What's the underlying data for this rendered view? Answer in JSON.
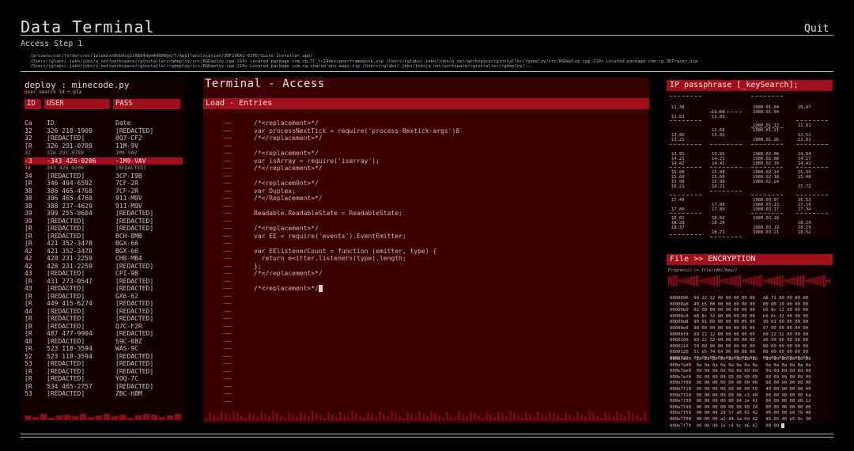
{
  "app": {
    "title": "Data Terminal",
    "quit_label": "Quit",
    "step": "Access Step 1",
    "paths": [
      "/private/var/folders/wc/1plpkbsn0hb0cg1t6884dym40000gn/T/AppTranslocation/30F196A1-03FE/Suite Installer.app/",
      "/Users/rglabs/.jekn/jobs/q_net/workspace/rginstaller/rgdeploy/src/RGDeploy.cpp:210> Located package com.rg.TC_tc14designerframework.zip /Users/rglabs/.jekn/jobs/q_net/workspace/rginstaller/rgdeploy/src/RGDeploy.cpp:210> Located package com.rg.3DTracer.zip",
      "/Users/rglabs/.jekn/jobs/q_net/workspace/rginstaller/rgdeploy/src/RGDeploy.cpp:210> Located package com.rg.shared-env-maps.zip /Users/rglabs/.jekn/jobs/q_net/workspace/rginstaller/rgdeploy/..."
    ]
  },
  "left_panel": {
    "title": "deploy : minecode.py",
    "search": "User search id + p[a",
    "headers": [
      "ID",
      "USER",
      "PASS"
    ],
    "rows": [
      [
        "Ca",
        "ID",
        "Date"
      ],
      [
        "32",
        "326 218-1909",
        "[REDACTED]"
      ],
      [
        "32",
        "[REDACTED]",
        "0Q7-CF2"
      ],
      [
        "[R",
        "326 291-0789",
        "11M-9V"
      ],
      [
        "32",
        "326 291-0789",
        "1M9-VAV"
      ],
      [
        "-3",
        "-343 426-0206",
        "-1M9-VAV"
      ],
      [
        "34",
        "343 426-0206",
        "[REDACTED]"
      ],
      [
        "34",
        "[REDACTED]",
        "3CP-I9B"
      ],
      [
        "[R",
        "346 494-6592",
        "7CF-2R"
      ],
      [
        "38",
        "386 465-4768",
        "7CF-2R"
      ],
      [
        "38",
        "386 465-4768",
        "911-M9V"
      ],
      [
        "38",
        "388 237-4629",
        "911-M9V"
      ],
      [
        "39",
        "399 255-8604",
        "[REDACTED]"
      ],
      [
        "39",
        "[REDACTED]",
        "[REDACTED]"
      ],
      [
        "[R",
        "[REDACTED]",
        "[REDACTED]"
      ],
      [
        "[R",
        "[REDACTED]",
        "BCH-8MB"
      ],
      [
        "[R",
        "421 352-3478",
        "BGX-66"
      ],
      [
        "42",
        "421 352-3478",
        "BGX-66"
      ],
      [
        "42",
        "428 231-2259",
        "CH8-MB4"
      ],
      [
        "42",
        "428 231-2259",
        "[REDACTED]"
      ],
      [
        "43",
        "[REDACTED]",
        "CPI-9B"
      ],
      [
        "[R",
        "431 273-0547",
        "[REDACTED]"
      ],
      [
        "43",
        "[REDACTED]",
        "[REDACTED]"
      ],
      [
        "[R",
        "[REDACTED]",
        "GX6-62"
      ],
      [
        "[R",
        "449 415-6274",
        "[REDACTED]"
      ],
      [
        "44",
        "[REDACTED]",
        "[REDACTED]"
      ],
      [
        "[R",
        "[REDACTED]",
        "[REDACTED]"
      ],
      [
        "[R",
        "[REDACTED]",
        "Q7C-F2R"
      ],
      [
        "[R",
        "487 477-9904",
        "[REDACTED]"
      ],
      [
        "48",
        "[REDACTED]",
        "S9C-08Z"
      ],
      [
        "[R",
        "523 118-3594",
        "WAS-9C"
      ],
      [
        "52",
        "523 118-3594",
        "[REDACTED]"
      ],
      [
        "53",
        "[REDACTED]",
        "[REDACTED]"
      ],
      [
        "[R",
        "[REDACTED]",
        "[REDACTED]"
      ],
      [
        "[R",
        "[REDACTED]",
        "YOQ-7C"
      ],
      [
        "[R",
        "534 465-2757",
        "[REDACTED]"
      ],
      [
        "53",
        "[REDACTED]",
        "ZBC-H8M"
      ]
    ],
    "selected_row": 5,
    "dim_rows": [
      4,
      6
    ]
  },
  "terminal": {
    "title": "Terminal - Access",
    "load_label": "Load - Entries",
    "dash": "——",
    "code": [
      "/*<replacement>*/",
      "var processNextTick = require('process-Bextick-args')8",
      "/*</replacement>*/",
      "",
      "/*<replacement>*/",
      "var isArray = require('isarray');",
      "/*</replacement>*/",
      "",
      "/*<replacem9nt>*/",
      "var Duplex;",
      "/*</Replacement>*/",
      "",
      "Readable.ReadableState = ReadableState;",
      "",
      "/*<replacement>*/",
      "var EE = require('events').EventEmitter;",
      "",
      "var EElistenerCount = function (emitter, type) {",
      "  return e<itter.listeners(type).length;",
      "};",
      "/*</replacement>*/",
      "",
      "/*<replacement>*/"
    ]
  },
  "ip_panel": {
    "title": "IP passphrase [_keySearch];",
    "rows": [
      [
        "11.38",
        "",
        "1980.01.04",
        "10.47"
      ],
      [
        "",
        "11.50",
        "1980.01.04",
        ""
      ],
      [
        "11.83",
        "11.83",
        "",
        ""
      ],
      [
        "",
        "",
        "1980.01.13",
        "11.91"
      ],
      [
        "",
        "12.68",
        "1980.01.21",
        ""
      ],
      [
        "13.02",
        "13.02",
        "",
        "12.51"
      ],
      [
        "13.21",
        "",
        "1980.01.26",
        "12.81"
      ],
      [
        "13.91",
        "13.91",
        "1980.02.06",
        "14.04"
      ],
      [
        "14.21",
        "14.21",
        "1980.02.08",
        "14.27"
      ],
      [
        "14.42",
        "14.42",
        "1980.02.10",
        "14.42"
      ],
      [
        "15.48",
        "15.48",
        "1980.02.14",
        "15.39"
      ],
      [
        "15.60",
        "15.60",
        "1980.02.18",
        "15.48"
      ],
      [
        "15.98",
        "15.98",
        "1980.02.24",
        ""
      ],
      [
        "16.21",
        "16.21",
        "",
        "15.72"
      ],
      [
        "17.48",
        "",
        "1980.03.07",
        "16.53"
      ],
      [
        "",
        "17.88",
        "1980.03.13",
        "17.16"
      ],
      [
        "17.89",
        "17.89",
        "1980.03.17",
        "17.34"
      ],
      [
        "18.02",
        "18.02",
        "1980.03.18",
        ""
      ],
      [
        "18.28",
        "18.28",
        "",
        "18.24"
      ],
      [
        "18.37",
        "",
        "1980.03.19",
        "18.29"
      ],
      [
        "",
        "18.71",
        "1980.03.21",
        "18.52"
      ]
    ]
  },
  "enc_panel": {
    "title": "File >> ENCRYPTION",
    "progress_label": "Progress// >> file/rdb//Key//",
    "hex_block_1": [
      "0000090  60 22 32 00 00 00 00 00   d8 71 00 00 00 00",
      "00000a0  48 b5 00 00 00 00 00 00   00 00 20 00 00 00",
      "00000b0  02 00 00 00 06 00 00 00   b0 8c 12 00 00 00",
      "00000c0  b0 8c 32 00 00 00 00 00   b0 8c 32 00 00 00",
      "00000d0  90 01 00 00 00 00 00 00   90 01 00 00 00 00",
      "00000e0  08 00 00 00 00 00 00 00   07 00 00 00 04 00",
      "00000f0  60 22 12 00 00 00 00 00   60 22 32 00 00 00",
      "0000100  60 22 32 00 00 00 00 00   d0 99 00 00 00 00",
      "0000110  10 00 00 00 00 00 00 00   00 00 00 00 00 00",
      "0000120  51 e5 74 64 06 00 00 00   00 00 00 00 00 00",
      "0000130  00 00 00 00 00 00 00 00   00 00 00 00 00 00"
    ],
    "hex_block_2": [
      "000e7ec0  20 20 20 20 20 20 20 20   20 20 20 20 20 20",
      "000e7ed0  0a 0a 0a 0a 0a 0a 0a 0a   0a 0a 0a 0a 0a 0a",
      "000e7ee0  0d 0d 0d 0d 0d 0d 0d 0d   0d 0d 0d 0d 0d 0d",
      "000e7ef0  09 09 09 09 09 09 09 09   09 09 09 09 09 09",
      "000e7f00  00 00 00 00 00 00 00 00   00 00 00 00 00 00",
      "000e7f10  00 00 00 00 00 00 00 59   40 00 00 00 00 40",
      "000e7f20  00 00 00 00 00 88 c3 40   00 00 00 00 00 6a",
      "000e7f30  00 00 00 00 80 84 2e 41   00 00 00 00 d0 12",
      "000e7f40  00 00 00 00 00 00 00 34   00 00 00 00 00 00",
      "000e7f50  00 00 00 20 5f a0 02 42   00 00 00 e8 76 48",
      "000e7f60  00 00 00 a2 94 1a 6d 42   00 00 40 e5 9c 30",
      "000e7f70  00 00 90 1e c4 bc d6 42   00 00 "
    ]
  }
}
